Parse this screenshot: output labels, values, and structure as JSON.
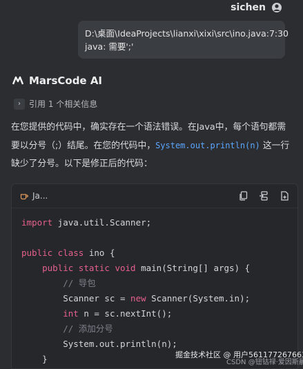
{
  "user": {
    "name": "sichen"
  },
  "user_message": {
    "line1": "D:\\桌面\\IdeaProjects\\lianxi\\xixi\\src\\ino.java:7:30",
    "line2": "java: 需要';'"
  },
  "assistant": {
    "name": "MarsCode AI",
    "reference_label": "引用 1 个相关信息",
    "answer_before": "在您提供的代码中，确实存在一个语法错误。在Java中，每个语句都需要以分号（;）结尾。在您的代码中，",
    "answer_code": "System.out.println(n)",
    "answer_after": " 这一行缺少了分号。以下是修正后的代码："
  },
  "code_block": {
    "language": "Ja...",
    "tools": [
      "copy-icon",
      "insert-icon",
      "new-file-icon"
    ],
    "lines": [
      {
        "t": [
          [
            "kw",
            "import"
          ],
          [
            "fn",
            " java.util.Scanner;"
          ]
        ]
      },
      {
        "t": [
          [
            "fn",
            ""
          ]
        ]
      },
      {
        "t": [
          [
            "kw",
            "public class"
          ],
          [
            "fn",
            " ino {"
          ]
        ]
      },
      {
        "t": [
          [
            "fn",
            "    "
          ],
          [
            "kw",
            "public static void"
          ],
          [
            "fn",
            " main(String[] args) {"
          ]
        ]
      },
      {
        "t": [
          [
            "cm",
            "        // 导包"
          ]
        ]
      },
      {
        "t": [
          [
            "fn",
            "        Scanner sc = "
          ],
          [
            "kw",
            "new"
          ],
          [
            "fn",
            " Scanner(System.in);"
          ]
        ]
      },
      {
        "t": [
          [
            "fn",
            "        "
          ],
          [
            "kw",
            "int"
          ],
          [
            "fn",
            " n = sc.nextInt();"
          ]
        ]
      },
      {
        "t": [
          [
            "cm",
            "        // 添加分号"
          ]
        ]
      },
      {
        "t": [
          [
            "fn",
            "        System.out.println(n);"
          ]
        ]
      },
      {
        "t": [
          [
            "fn",
            "    }"
          ]
        ]
      }
    ]
  },
  "watermark": {
    "line1": "掘金技术社区 @ 用户561177267663",
    "line2": "CSDN @钮钴禄·爱因斯晨"
  }
}
